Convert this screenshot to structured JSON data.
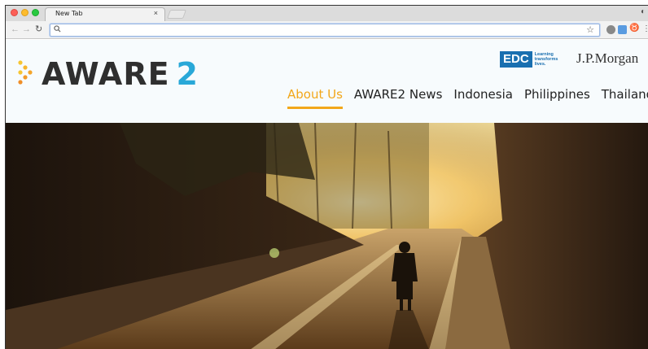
{
  "browser": {
    "tab_title": "New Tab",
    "tab_close": "×",
    "address_value": "",
    "icons": {
      "back": "left-arrow-icon",
      "forward": "right-arrow-icon",
      "reload": "reload-icon",
      "search": "search-icon",
      "bookmark": "star-icon",
      "menu": "menu-dots-icon"
    }
  },
  "site": {
    "logo_main": "AWARE",
    "logo_num": "2",
    "edc_label": "EDC",
    "edc_tagline": "Learning transforms lives.",
    "jpm_label": "J.P.Morgan",
    "nav": [
      {
        "label": "About Us",
        "active": true
      },
      {
        "label": "AWARE2 News",
        "active": false
      },
      {
        "label": "Indonesia",
        "active": false
      },
      {
        "label": "Philippines",
        "active": false
      },
      {
        "label": "Thailand",
        "active": false
      }
    ],
    "colors": {
      "accent": "#f2a71a",
      "brand_blue": "#29a8d8",
      "edc_blue": "#1a6fb0"
    }
  },
  "hero": {
    "description_icon": "street-photo-hero"
  }
}
